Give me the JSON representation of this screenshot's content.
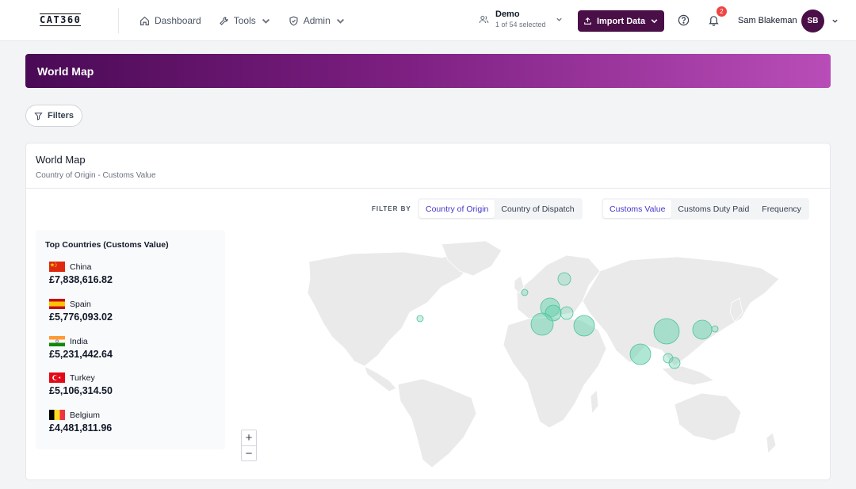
{
  "header": {
    "logo": "CAT360",
    "nav": [
      {
        "label": "Dashboard",
        "icon": "home-icon"
      },
      {
        "label": "Tools",
        "icon": "wrench-icon"
      },
      {
        "label": "Admin",
        "icon": "shield-icon"
      }
    ],
    "org": {
      "name": "Demo",
      "sub": "1 of 54 selected"
    },
    "import_label": "Import Data",
    "notification_count": "2",
    "user_name": "Sam Blakeman",
    "user_initials": "SB"
  },
  "banner": {
    "title": "World Map"
  },
  "filters_label": "Filters",
  "card": {
    "title": "World Map",
    "subtitle": "Country of Origin - Customs Value",
    "filter_by_label": "FILTER BY",
    "origin_options": [
      {
        "label": "Country of Origin",
        "active": true
      },
      {
        "label": "Country of Dispatch",
        "active": false
      }
    ],
    "metric_options": [
      {
        "label": "Customs Value",
        "active": true
      },
      {
        "label": "Customs Duty Paid",
        "active": false
      },
      {
        "label": "Frequency",
        "active": false
      }
    ],
    "top_title": "Top Countries (Customs Value)",
    "top_countries": [
      {
        "name": "China",
        "value": "£7,838,616.82",
        "flag": "china"
      },
      {
        "name": "Spain",
        "value": "£5,776,093.02",
        "flag": "spain"
      },
      {
        "name": "India",
        "value": "£5,231,442.64",
        "flag": "india"
      },
      {
        "name": "Turkey",
        "value": "£5,106,314.50",
        "flag": "turkey"
      },
      {
        "name": "Belgium",
        "value": "£4,481,811.96",
        "flag": "belgium"
      }
    ],
    "zoom_in": "+",
    "zoom_out": "−"
  },
  "colors": {
    "accent": "#4a0f47",
    "bubble": "#6fd3b0",
    "active_tab": "#4338ca"
  }
}
